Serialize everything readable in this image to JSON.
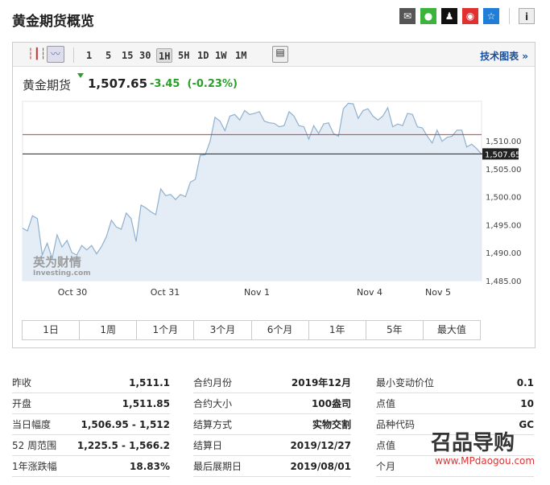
{
  "header": {
    "title": "黄金期货概览",
    "share_icons": [
      "email-icon",
      "wechat-icon",
      "qq-icon",
      "weibo-icon",
      "favorite-icon"
    ],
    "info_icon": "info-icon"
  },
  "toolbar": {
    "intervals": [
      "1",
      "5",
      "15",
      "30",
      "1H",
      "5H",
      "1D",
      "1W",
      "1M"
    ],
    "selected": "1H",
    "tech_chart": "技术图表 »"
  },
  "quote": {
    "name": "黄金期货",
    "price": "1,507.65",
    "change": "-3.45",
    "change_pct": "(-0.23%)",
    "color_down": "#2a9d2a"
  },
  "chart_data": {
    "type": "area",
    "ylim": [
      1485,
      1518.5
    ],
    "yticks": [
      "1,510.00",
      "1,505.00",
      "1,500.00",
      "1,495.00",
      "1,490.00",
      "1,485.00"
    ],
    "xticks": [
      "Oct 30",
      "Oct 31",
      "Nov 1",
      "Nov 4",
      "Nov 5"
    ],
    "last_label": "1,507.65",
    "last_value": 1507.65,
    "prev_close": 1511.1,
    "values": [
      1494.4,
      1493.9,
      1496.6,
      1496.1,
      1489.6,
      1491.7,
      1489,
      1493.2,
      1491,
      1492.2,
      1490,
      1489.6,
      1491.3,
      1490.5,
      1491.3,
      1489.8,
      1491.1,
      1492.9,
      1495.8,
      1494.6,
      1494.2,
      1497.1,
      1496.1,
      1492,
      1498.5,
      1498,
      1497.3,
      1496.8,
      1501.4,
      1500.2,
      1500.4,
      1499.5,
      1500.4,
      1500,
      1502.6,
      1503.1,
      1507.4,
      1507.5,
      1509.9,
      1514.2,
      1513.5,
      1511.8,
      1514.4,
      1514.7,
      1513.7,
      1515.4,
      1514.7,
      1514.9,
      1515.2,
      1513.5,
      1513.2,
      1513.1,
      1512.5,
      1512.7,
      1515.2,
      1514.4,
      1512.7,
      1512.5,
      1510.3,
      1512.7,
      1511.3,
      1513,
      1513.2,
      1511.3,
      1510.8,
      1515.7,
      1516.7,
      1516.6,
      1514,
      1515.4,
      1515.7,
      1514.4,
      1513.7,
      1514.4,
      1515.9,
      1512.5,
      1513,
      1512.7,
      1514.9,
      1514.7,
      1512.5,
      1512.3,
      1510.8,
      1509.6,
      1511.9,
      1509.9,
      1510.6,
      1510.8,
      1511.9,
      1511.9,
      1508.9,
      1509.4,
      1508.6,
      1507.6
    ],
    "line_color": "#8fb0cf",
    "fill_color": "#e4edf5",
    "prev_close_color": "#d33",
    "watermark": "英为财情 Investing.com"
  },
  "ranges": [
    "1日",
    "1周",
    "1个月",
    "3个月",
    "6个月",
    "1年",
    "5年",
    "最大值"
  ],
  "table": [
    [
      [
        "昨收",
        "1,511.1"
      ],
      [
        "开盘",
        "1,511.85"
      ],
      [
        "当日幅度",
        "1,506.95 - 1,512"
      ],
      [
        "52 周范围",
        "1,225.5 - 1,566.2"
      ],
      [
        "1年涨跌幅",
        "18.83%"
      ]
    ],
    [
      [
        "合约月份",
        "2019年12月"
      ],
      [
        "合约大小",
        "100盎司"
      ],
      [
        "结算方式",
        "实物交割"
      ],
      [
        "结算日",
        "2019/12/27"
      ],
      [
        "最后展期日",
        "2019/08/01"
      ]
    ],
    [
      [
        "最小变动价位",
        "0.1"
      ],
      [
        "点值",
        "10"
      ],
      [
        "品种代码",
        "GC"
      ],
      [
        "点值",
        ""
      ],
      [
        "个月",
        ""
      ]
    ]
  ],
  "overlay": {
    "logo": "召品导购",
    "url": "www.MPdaogou.com"
  }
}
